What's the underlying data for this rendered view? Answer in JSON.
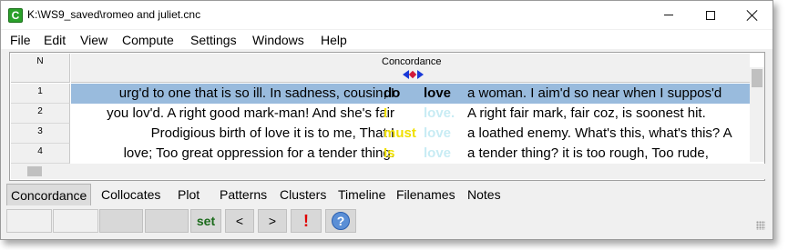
{
  "window": {
    "title": "K:\\WS9_saved\\romeo and juliet.cnc",
    "app_icon": "C"
  },
  "menu": [
    "File",
    "Edit",
    "View",
    "Compute",
    "Settings",
    "Windows",
    "Help"
  ],
  "grid": {
    "columns": {
      "n": "N",
      "concordance": "Concordance"
    },
    "rows": [
      {
        "n": "1",
        "left": "urg'd to one that is so ill. In sadness, cousin, I",
        "pre": "do",
        "node": "love",
        "right": "a woman. I aim'd so near when I suppos'd",
        "selected": true,
        "pre_style": "bold",
        "node_style": "bold"
      },
      {
        "n": "2",
        "left": "you lov'd. A right good mark-man! And she's fair",
        "pre": "I",
        "node": "love.",
        "right": "A right fair mark, fair coz, is soonest hit.",
        "selected": false,
        "pre_style": "yellow",
        "node_style": "faint"
      },
      {
        "n": "3",
        "left": "Prodigious birth of love it is to me, That I",
        "pre": "must",
        "node": "love",
        "right": "a loathed enemy. What's this, what's this? A",
        "selected": false,
        "pre_style": "yellow",
        "node_style": "faint"
      },
      {
        "n": "4",
        "left": "love; Too great oppression for a tender thing.",
        "pre": "Is",
        "node": "love",
        "right": "a tender thing? it is too rough, Too rude,",
        "selected": false,
        "pre_style": "yellow",
        "node_style": "faint"
      }
    ]
  },
  "tabs": [
    "Concordance",
    "Collocates",
    "Plot",
    "Patterns",
    "Clusters",
    "Timeline",
    "Filenames",
    "Notes"
  ],
  "active_tab": "Concordance",
  "statusbar": {
    "set_label": "set",
    "prev_label": "<",
    "next_label": ">",
    "alert_label": "!",
    "help_label": "?"
  },
  "colors": {
    "selection": "#99bbdd",
    "pre_highlight": "#f0e000",
    "node_faint": "#c8ecf4",
    "sort_arrow": "#1a3ad8",
    "alert": "#e00000"
  }
}
